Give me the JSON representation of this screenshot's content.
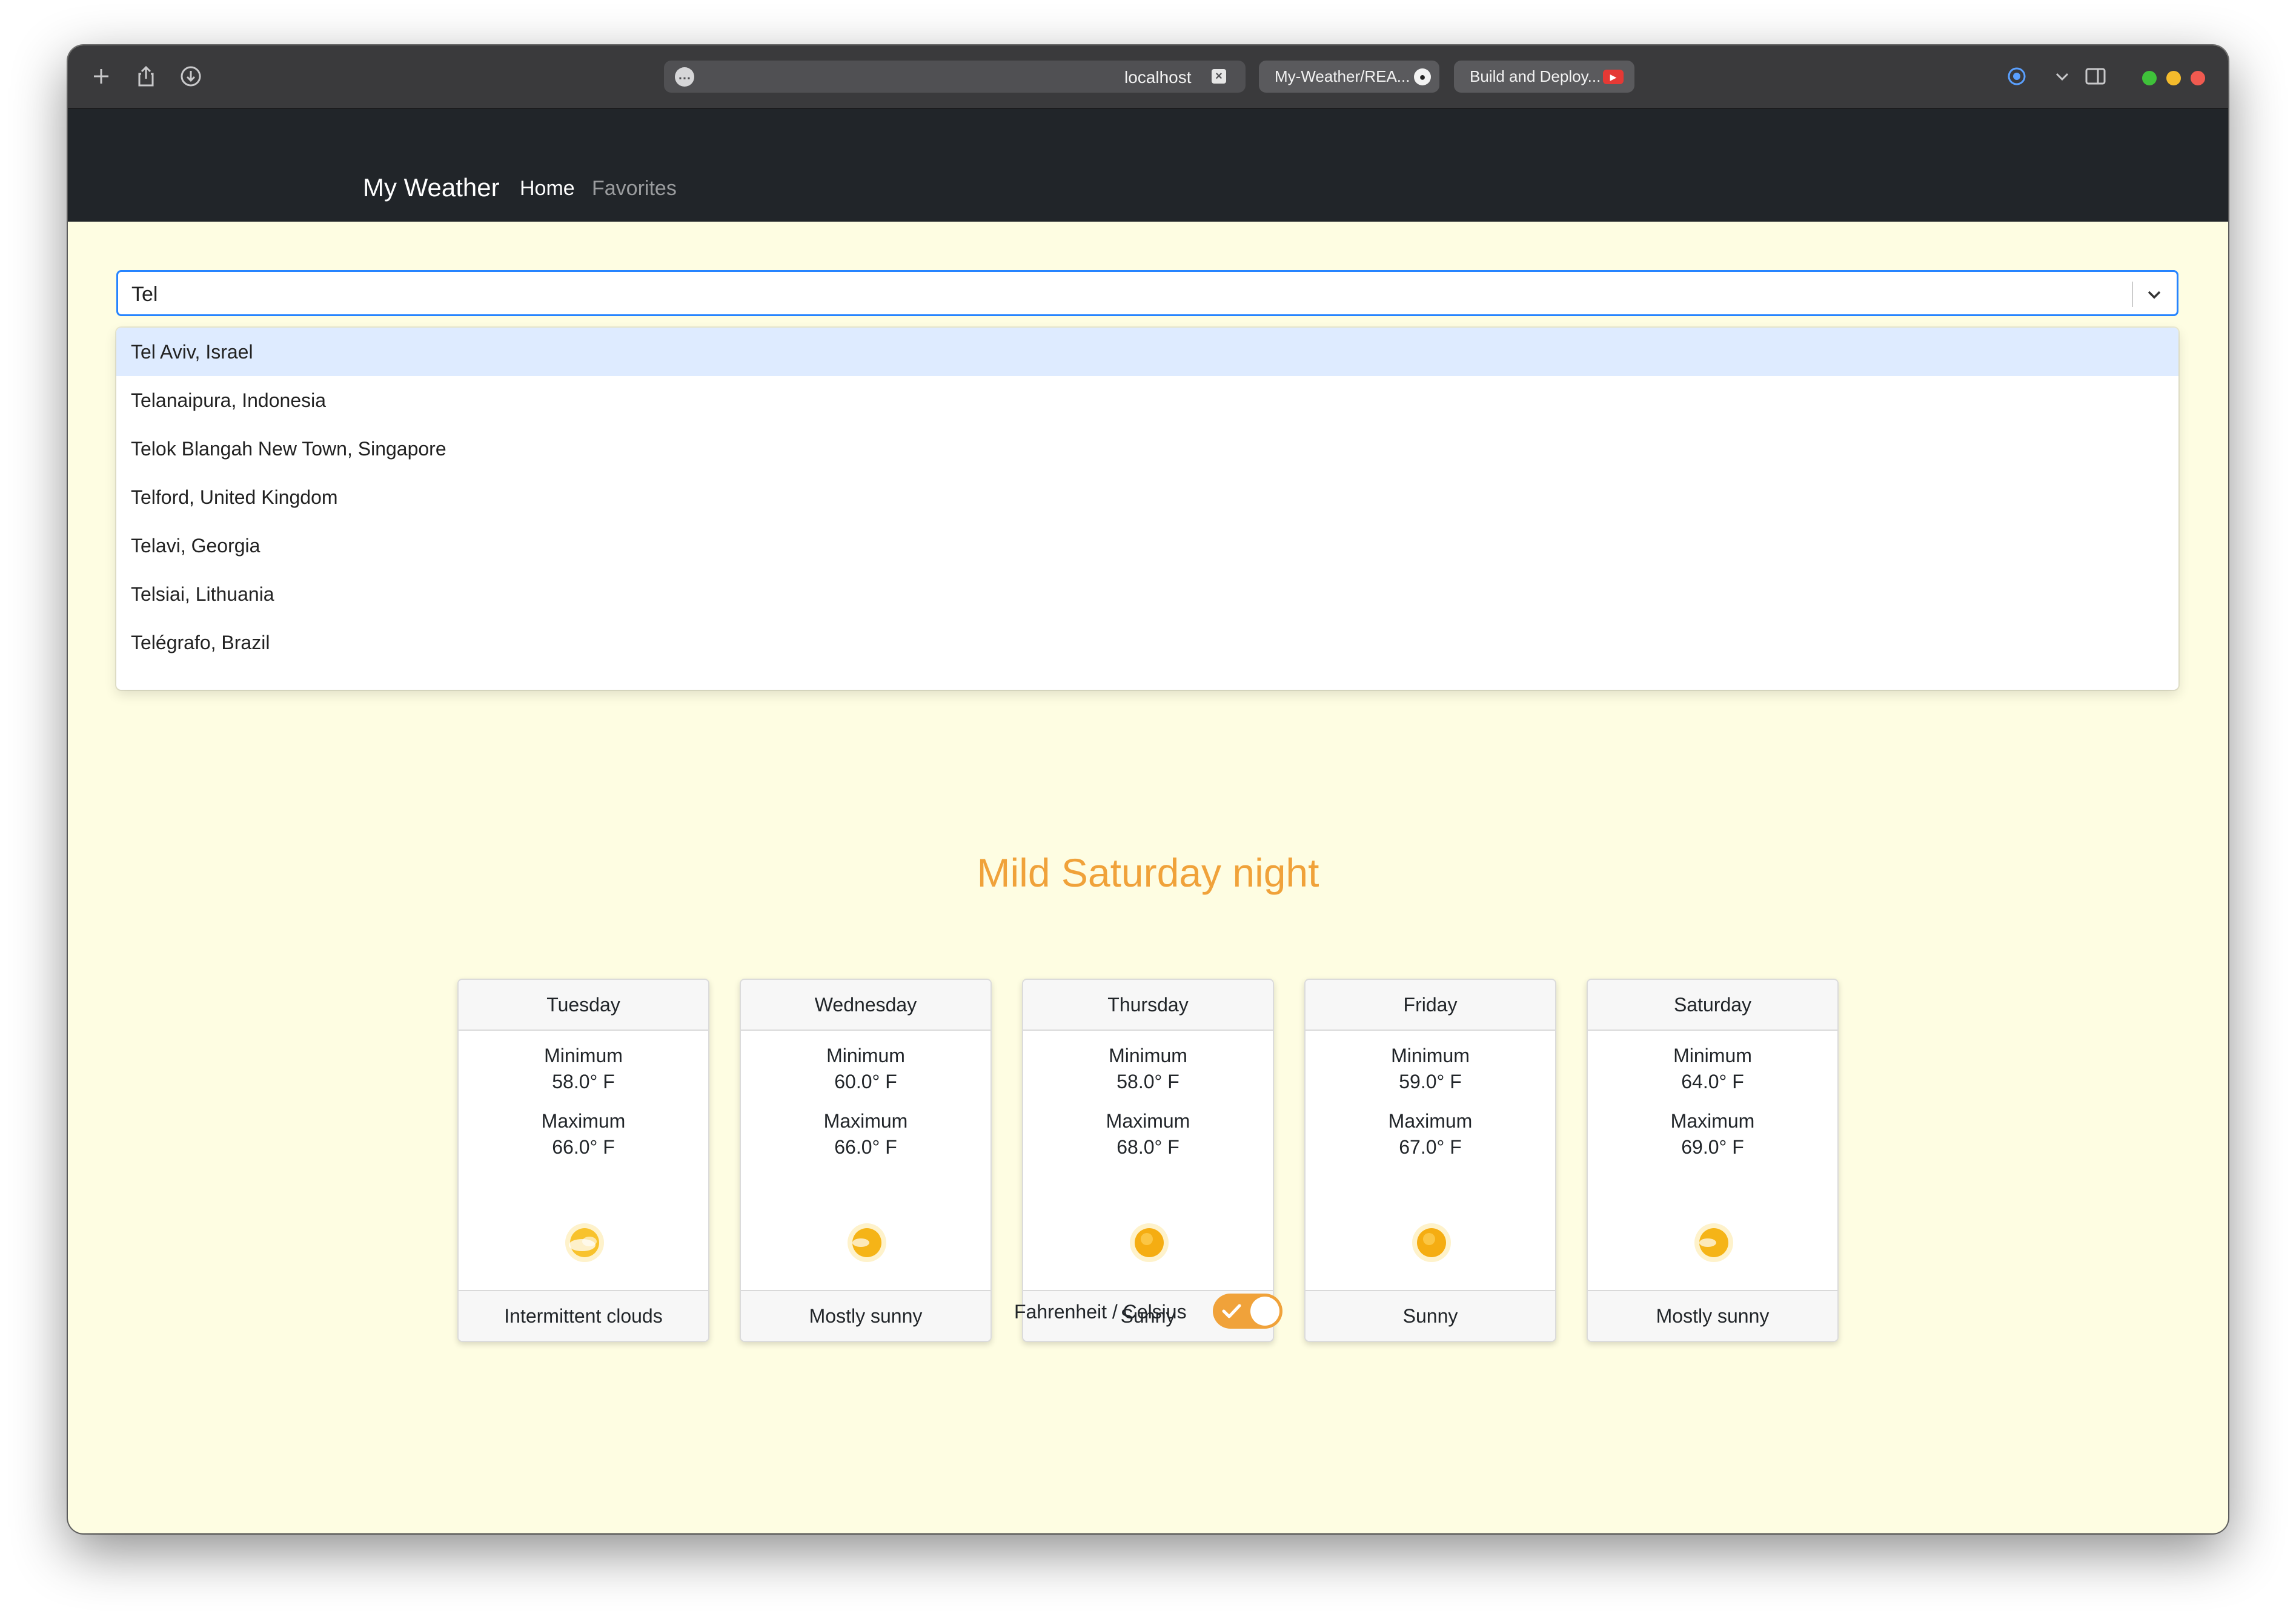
{
  "browser": {
    "url": "localhost",
    "tabs": [
      {
        "label": "My-Weather/REA..."
      },
      {
        "label": "Build and Deploy..."
      }
    ]
  },
  "navbar": {
    "brand": "My Weather",
    "links": [
      {
        "label": "Home",
        "active": true
      },
      {
        "label": "Favorites",
        "active": false
      }
    ]
  },
  "search": {
    "value": "Tel",
    "options": [
      "Tel Aviv, Israel",
      "Telanaipura, Indonesia",
      "Telok Blangah New Town, Singapore",
      "Telford, United Kingdom",
      "Telavi, Georgia",
      "Telsiai, Lithuania",
      "Telégrafo, Brazil"
    ]
  },
  "headline": "Mild Saturday night",
  "forecast": [
    {
      "day": "Tuesday",
      "min_label": "Minimum",
      "min": "58.0° F",
      "max_label": "Maximum",
      "max": "66.0° F",
      "icon": "intermittent-clouds-icon",
      "condition": "Intermittent clouds"
    },
    {
      "day": "Wednesday",
      "min_label": "Minimum",
      "min": "60.0° F",
      "max_label": "Maximum",
      "max": "66.0° F",
      "icon": "mostly-sunny-icon",
      "condition": "Mostly sunny"
    },
    {
      "day": "Thursday",
      "min_label": "Minimum",
      "min": "58.0° F",
      "max_label": "Maximum",
      "max": "68.0° F",
      "icon": "sunny-icon",
      "condition": "Sunny"
    },
    {
      "day": "Friday",
      "min_label": "Minimum",
      "min": "59.0° F",
      "max_label": "Maximum",
      "max": "67.0° F",
      "icon": "sunny-icon",
      "condition": "Sunny"
    },
    {
      "day": "Saturday",
      "min_label": "Minimum",
      "min": "64.0° F",
      "max_label": "Maximum",
      "max": "69.0° F",
      "icon": "mostly-sunny-icon",
      "condition": "Mostly sunny"
    }
  ],
  "unit_toggle": {
    "label": "Fahrenheit / Celsius",
    "checked": true
  },
  "colors": {
    "accent": "#f0a23a",
    "page_background": "#fefde2",
    "navbar": "#212529",
    "option_focus": "#deebff",
    "input_focus_border": "#2684ff"
  }
}
